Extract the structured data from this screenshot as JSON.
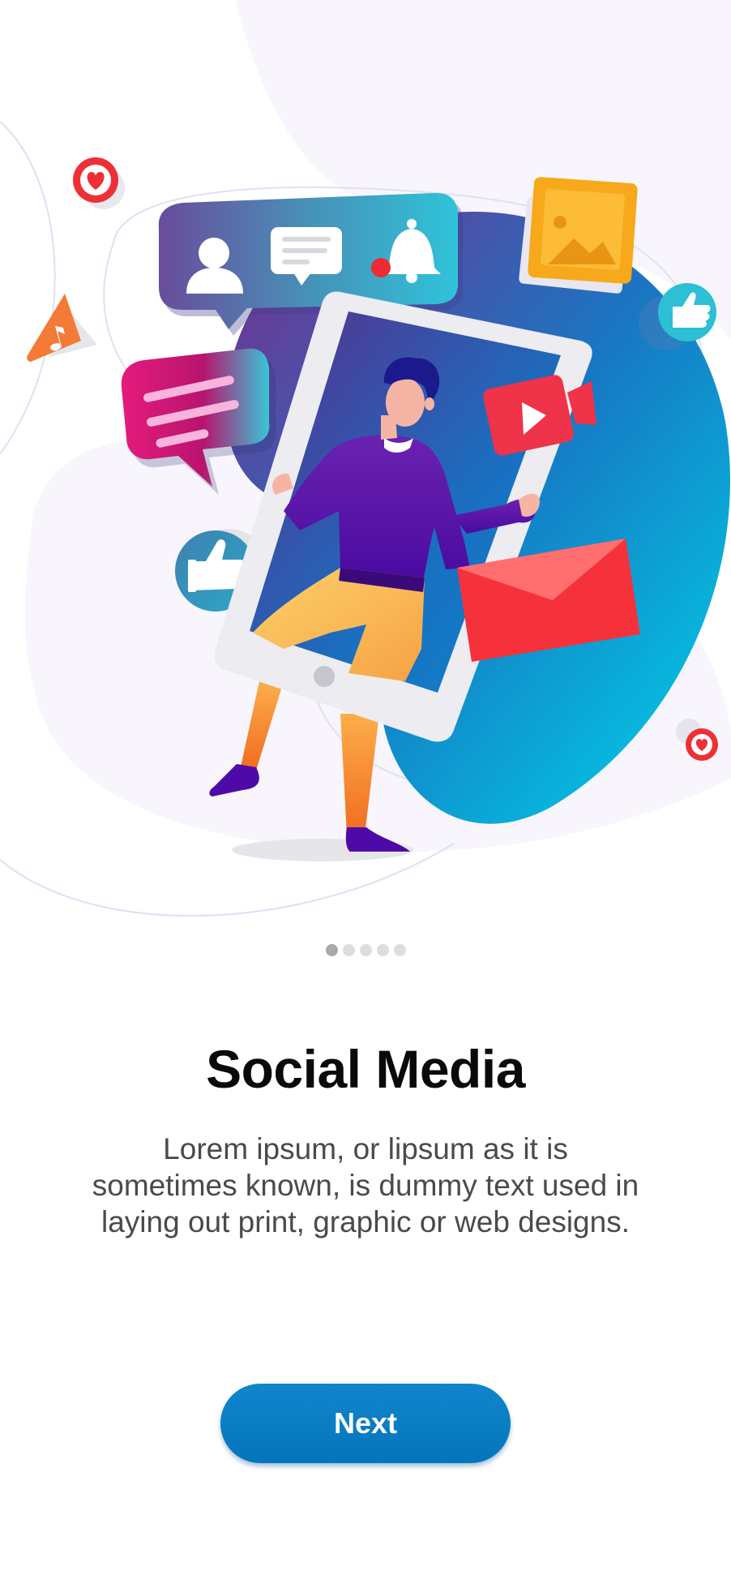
{
  "onboarding": {
    "title": "Social Media",
    "description": "Lorem ipsum, or lipsum as it is sometimes known, is dummy text used in laying out print, graphic or web designs.",
    "next_label": "Next",
    "pager": {
      "total": 5,
      "active_index": 0
    }
  },
  "illustration": {
    "subject": "person-in-phone-frame",
    "icons": [
      "heart-icon",
      "music-note-icon",
      "user-icon",
      "message-icon",
      "bell-icon",
      "image-icon",
      "thumbs-up-icon",
      "video-camera-icon",
      "text-bubble-icon",
      "mail-envelope-icon"
    ]
  },
  "colors": {
    "button": "#0475bc",
    "title": "#0a0a0a",
    "description": "#4a4a4a",
    "dot_active": "#a9a9ad",
    "dot_inactive": "#dddde0",
    "blob_start": "#7b2d8e",
    "blob_end": "#00c8e6",
    "accent_red": "#f2323e",
    "accent_orange": "#f58a3a",
    "accent_yellow": "#f7b21b"
  }
}
